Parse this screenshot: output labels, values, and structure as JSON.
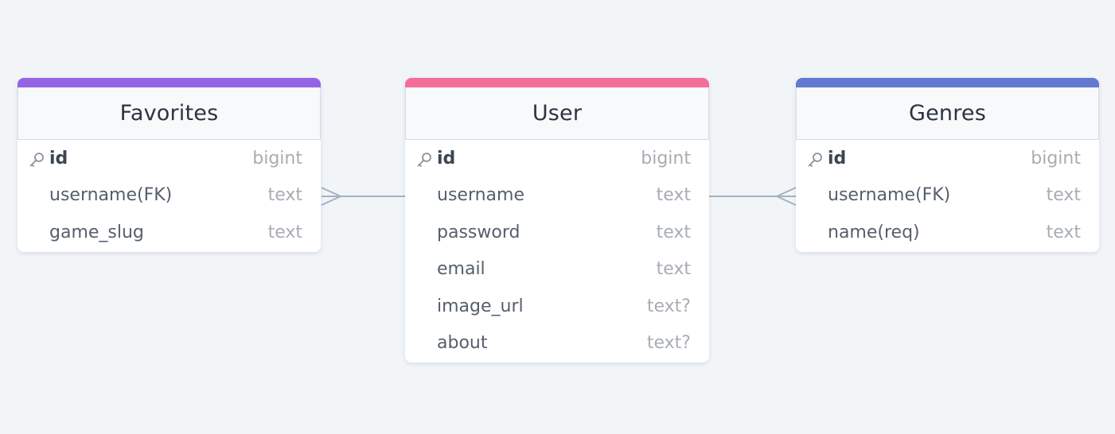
{
  "colors": {
    "background": "#f1f5f8",
    "favorites_accent": "#9563e6",
    "user_accent": "#f56e9a",
    "genres_accent": "#6479d0",
    "connector": "#a3b3c4"
  },
  "tables": {
    "favorites": {
      "title": "Favorites",
      "fields": [
        {
          "name": "id",
          "type": "bigint",
          "primary_key": true
        },
        {
          "name": "username(FK)",
          "type": "text"
        },
        {
          "name": "game_slug",
          "type": "text"
        }
      ]
    },
    "user": {
      "title": "User",
      "fields": [
        {
          "name": "id",
          "type": "bigint",
          "primary_key": true
        },
        {
          "name": "username",
          "type": "text"
        },
        {
          "name": "password",
          "type": "text"
        },
        {
          "name": "email",
          "type": "text"
        },
        {
          "name": "image_url",
          "type": "text?"
        },
        {
          "name": "about",
          "type": "text?"
        }
      ]
    },
    "genres": {
      "title": "Genres",
      "fields": [
        {
          "name": "id",
          "type": "bigint",
          "primary_key": true
        },
        {
          "name": "username(FK)",
          "type": "text"
        },
        {
          "name": "name(req)",
          "type": "text"
        }
      ]
    }
  },
  "relations": [
    {
      "from": "user.username",
      "to": "favorites.username(FK)",
      "cardinality": "one-to-many"
    },
    {
      "from": "user.username",
      "to": "genres.username(FK)",
      "cardinality": "one-to-many"
    }
  ]
}
